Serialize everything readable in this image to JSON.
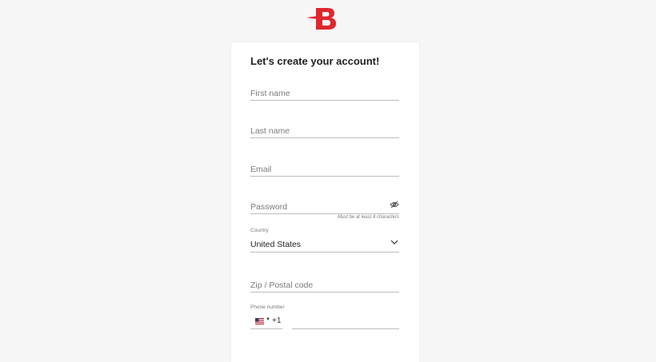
{
  "brand": {
    "logo_letter": "B",
    "accent_color": "#e0262e"
  },
  "form": {
    "title": "Let's create your account!",
    "first_name": {
      "placeholder": "First name",
      "value": ""
    },
    "last_name": {
      "placeholder": "Last name",
      "value": ""
    },
    "email": {
      "placeholder": "Email",
      "value": ""
    },
    "password": {
      "placeholder": "Password",
      "value": "",
      "hint": "Must be at least 8 characters",
      "toggle_icon": "eye-off-icon"
    },
    "country": {
      "label": "Country",
      "value": "United States",
      "icon": "chevron-down-icon"
    },
    "zip": {
      "placeholder": "Zip / Postal code",
      "value": ""
    },
    "phone": {
      "label": "Phone number",
      "country_flag": "us-flag-icon",
      "dial_code": "+1",
      "value": ""
    }
  }
}
